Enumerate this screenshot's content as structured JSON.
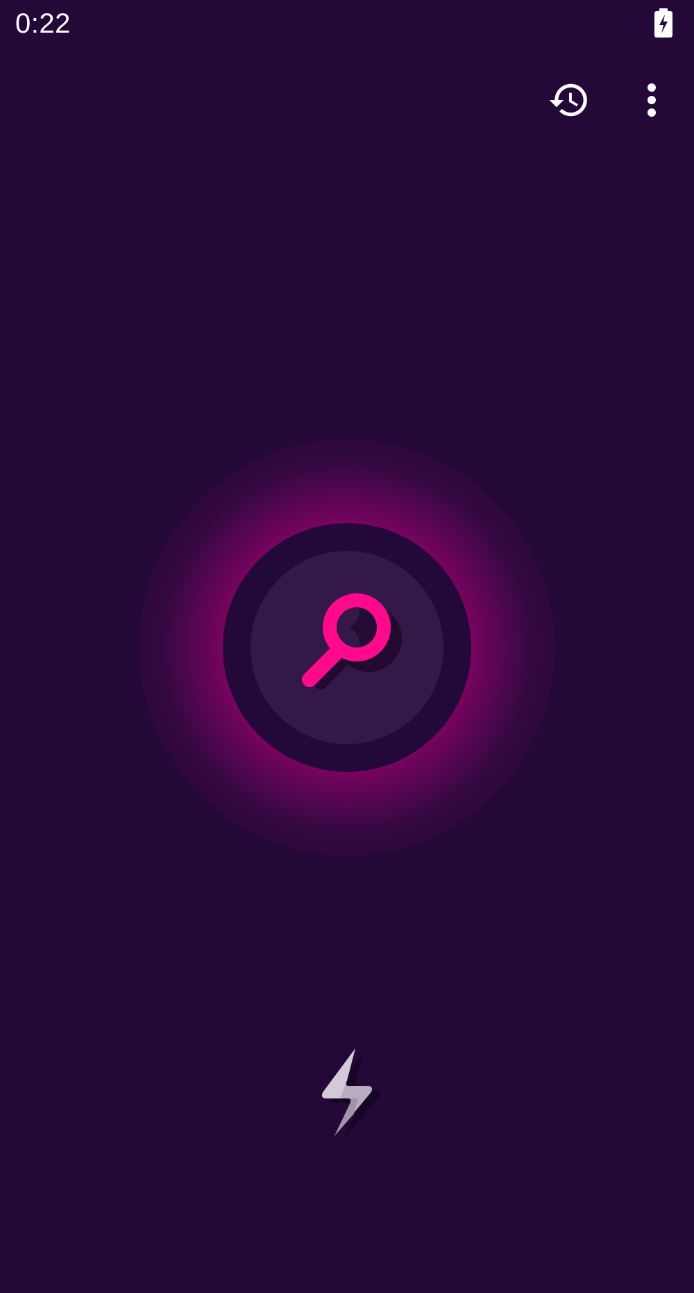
{
  "status_bar": {
    "time": "0:22",
    "battery_icon": "battery-charging-icon"
  },
  "toolbar": {
    "history_icon": "history-icon",
    "menu_icon": "more-vert-icon"
  },
  "scanner": {
    "scan_icon": "magnifier-icon",
    "flash_icon": "lightning-bolt-icon"
  },
  "colors": {
    "background": "#230838",
    "accent": "#ff0a8c",
    "button_inner": "#331849",
    "icon_white": "#ffffff"
  }
}
